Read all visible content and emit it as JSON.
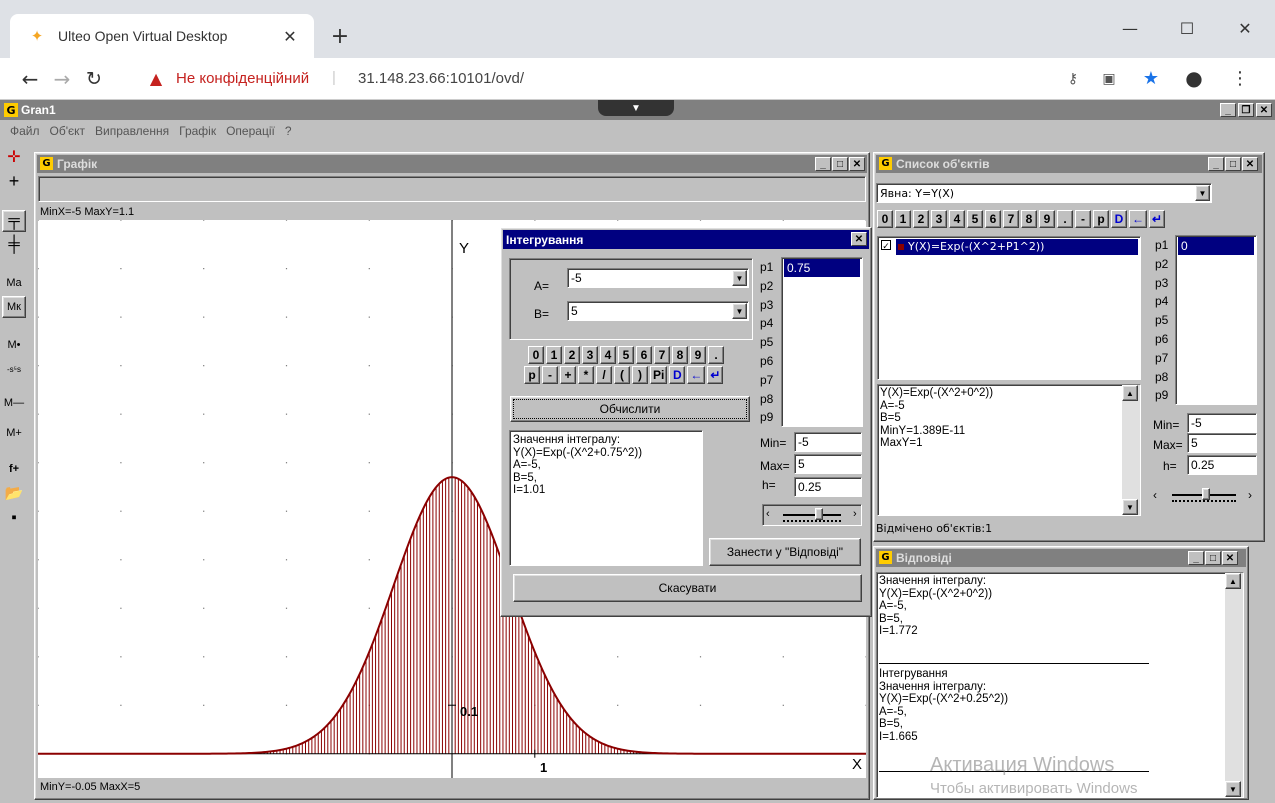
{
  "browser": {
    "tab_title": "Ulteo Open Virtual Desktop",
    "new_tab": "+",
    "warning": "Не конфіденційний",
    "separator": "|",
    "url": "31.148.23.66:10101/ovd/"
  },
  "app": {
    "title": "Gran1",
    "menu": [
      "Файл",
      "Об'єкт",
      "Виправлення",
      "Графік",
      "Операції",
      "?"
    ]
  },
  "sidebar": {
    "ma": "Mа",
    "mk": "Mк",
    "mdot": "M•",
    "s5s": "-s⁵s",
    "mminus": "M—",
    "mplus": "M+",
    "fplus": "f+"
  },
  "graph_window": {
    "title": "Графік",
    "top_info": "MinX=-5  MaxY=1.1",
    "bottom_info": "MinY=-0.05  MaxX=5",
    "y_label": "Y",
    "x_label": "X",
    "tick_1": "1",
    "tick_01": "0.1"
  },
  "chart_data": {
    "type": "line",
    "function": "Y(X)=Exp(-(X^2+0.75^2))",
    "xlim": [
      -5,
      5
    ],
    "ylim": [
      -0.05,
      1.1
    ],
    "peak": 0.57,
    "x_tick": 1,
    "y_tick": 0.1,
    "fill_from": -5,
    "fill_to": 5,
    "line_color": "#8b0000"
  },
  "integration_dialog": {
    "title": "Інтегрування",
    "a_label": "A=",
    "a_value": "-5",
    "b_label": "B=",
    "b_value": "5",
    "keys_row1": [
      "0",
      "1",
      "2",
      "3",
      "4",
      "5",
      "6",
      "7",
      "8",
      "9",
      "."
    ],
    "keys_row2": [
      "p",
      "-",
      "+",
      "*",
      "/",
      "(",
      ")",
      "Pi",
      "D",
      "←",
      "↵"
    ],
    "compute": "Обчислити",
    "params": [
      {
        "label": "p1",
        "value": "0.75"
      },
      {
        "label": "p2",
        "value": ""
      },
      {
        "label": "p3",
        "value": ""
      },
      {
        "label": "p4",
        "value": ""
      },
      {
        "label": "p5",
        "value": ""
      },
      {
        "label": "p6",
        "value": ""
      },
      {
        "label": "p7",
        "value": ""
      },
      {
        "label": "p8",
        "value": ""
      },
      {
        "label": "p9",
        "value": ""
      }
    ],
    "result": "Значення інтегралу:\nY(X)=Exp(-(X^2+0.75^2))\nA=-5,\nB=5,\nI=1.01",
    "min_label": "Min=",
    "min_value": "-5",
    "max_label": "Max=",
    "max_value": "5",
    "h_label": "h=",
    "h_value": "0.25",
    "to_answers": "Занести у \"Відповіді\"",
    "cancel": "Скасувати"
  },
  "objects_window": {
    "title": "Список об'єктів",
    "type_select": "Явна: Y=Y(X)",
    "keys": [
      "0",
      "1",
      "2",
      "3",
      "4",
      "5",
      "6",
      "7",
      "8",
      "9",
      ".",
      "-",
      "p",
      "D",
      "←",
      "↵"
    ],
    "item": "Y(X)=Exp(-(X^2+P1^2))",
    "params": [
      {
        "label": "p1",
        "value": "0"
      },
      {
        "label": "p2",
        "value": ""
      },
      {
        "label": "p3",
        "value": ""
      },
      {
        "label": "p4",
        "value": ""
      },
      {
        "label": "p5",
        "value": ""
      },
      {
        "label": "p6",
        "value": ""
      },
      {
        "label": "p7",
        "value": ""
      },
      {
        "label": "p8",
        "value": ""
      },
      {
        "label": "p9",
        "value": ""
      }
    ],
    "info": "Y(X)=Exp(-(X^2+0^2))\nA=-5\nB=5\nMinY=1.389E-11\nMaxY=1",
    "min_label": "Min=",
    "min_value": "-5",
    "max_label": "Max=",
    "max_value": "5",
    "h_label": "h=",
    "h_value": "0.25",
    "status": "Відмічено об'єктів:1"
  },
  "answers_window": {
    "title": "Відповіді",
    "text1": "Значення інтегралу:\nY(X)=Exp(-(X^2+0^2))\nA=-5,\nB=5,\nI=1.772",
    "text2": "Інтегрування\nЗначення інтегралу:\nY(X)=Exp(-(X^2+0.25^2))\nA=-5,\nB=5,\nI=1.665"
  },
  "watermark": {
    "line1": "Активация Windows",
    "line2": "Чтобы активировать Windows"
  },
  "colors": {
    "titlebar_active": "#000080",
    "titlebar_inactive": "#808080",
    "face": "#c0c0c0",
    "chrome_tabbar": "#dee1e6",
    "warning_red": "#c5221f",
    "star_blue": "#1a73e8"
  }
}
